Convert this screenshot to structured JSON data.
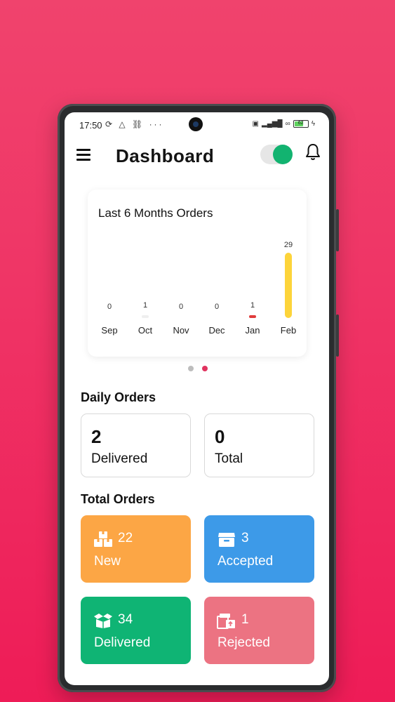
{
  "status_bar": {
    "time": "17:50",
    "icons": [
      "sync-icon",
      "drive-icon",
      "link-icon",
      "more-dots"
    ],
    "more": "···",
    "right_icons": [
      "volte-icon",
      "signal-5g-icon",
      "data-icon"
    ],
    "battery": "62"
  },
  "header": {
    "title": "Dashboard"
  },
  "chart_data": {
    "type": "bar",
    "title": "Last 6 Months Orders",
    "categories": [
      "Sep",
      "Oct",
      "Nov",
      "Dec",
      "Jan",
      "Feb"
    ],
    "values": [
      0,
      1,
      0,
      0,
      1,
      29
    ],
    "bar_colors": [
      "#e8e8e8",
      "#efefef",
      "#e8e8e8",
      "#e8e8e8",
      "#e03c3c",
      "#fdd43a"
    ],
    "xlabel": "",
    "ylabel": "",
    "ylim": [
      0,
      29
    ],
    "grid": false
  },
  "carousel": {
    "pages": 2,
    "active": 1,
    "dot_colors": [
      "#bdbdbd",
      "#e0335f"
    ]
  },
  "daily_orders": {
    "title": "Daily Orders",
    "items": [
      {
        "value": "2",
        "label": "Delivered"
      },
      {
        "value": "0",
        "label": "Total"
      }
    ]
  },
  "total_orders": {
    "title": "Total Orders",
    "items": [
      {
        "count": "22",
        "label": "New",
        "color": "#fca645",
        "icon": "boxes-icon"
      },
      {
        "count": "3",
        "label": "Accepted",
        "color": "#3d9ae8",
        "icon": "box-icon"
      },
      {
        "count": "34",
        "label": "Delivered",
        "color": "#0fb474",
        "icon": "open-box-icon"
      },
      {
        "count": "1",
        "label": "Rejected",
        "color": "#ec7382",
        "icon": "return-box-icon"
      }
    ]
  },
  "colors": {
    "background_top": "#f0436d",
    "background_bottom": "#ee1c57",
    "toggle_on": "#12b370"
  }
}
